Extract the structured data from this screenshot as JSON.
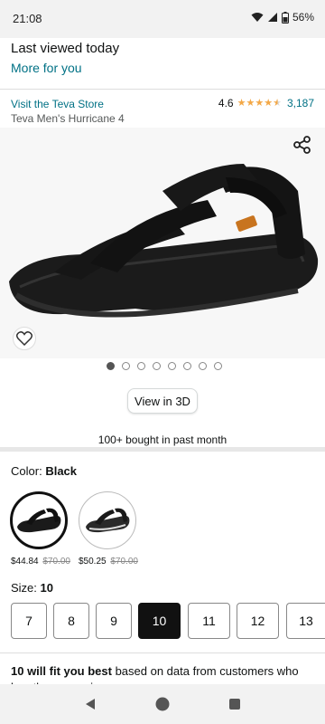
{
  "status_bar": {
    "time": "21:08",
    "battery": "56%"
  },
  "last_viewed": {
    "title": "Last viewed today",
    "more_link": "More for you"
  },
  "product": {
    "store_link": "Visit the Teva Store",
    "name": "Teva Men's Hurricane 4",
    "rating": "4.6",
    "rating_stars": 4.5,
    "rating_count": "3,187"
  },
  "gallery": {
    "image_count": 8,
    "active_index": 0,
    "view_3d_label": "View in 3D",
    "share_icon": "share-icon",
    "wishlist_icon": "heart-icon"
  },
  "social_proof": "100+ bought in past month",
  "color": {
    "label": "Color:",
    "selected": "Black",
    "options": [
      {
        "price": "$44.84",
        "list_price": "$70.00"
      },
      {
        "price": "$50.25",
        "list_price": "$70.00"
      }
    ]
  },
  "size": {
    "label": "Size:",
    "selected": "10",
    "options": [
      "7",
      "8",
      "9",
      "10",
      "11",
      "12",
      "13"
    ]
  },
  "fit": {
    "bold": "10 will fit you best",
    "text": " based on data from customers who buy the same sizes as you"
  },
  "colors": {
    "link": "#007185",
    "star": "#f3a847",
    "selected": "#111111"
  }
}
